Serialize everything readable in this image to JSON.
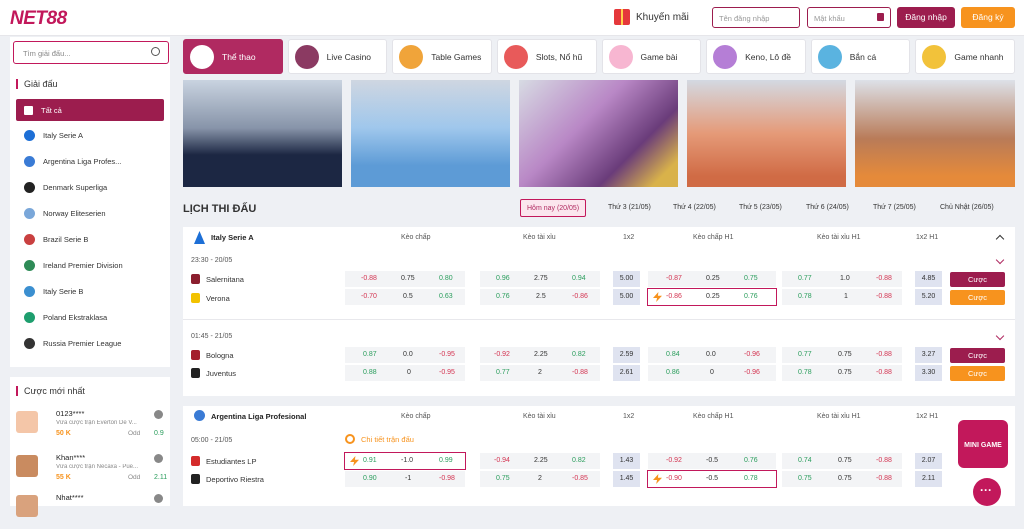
{
  "header": {
    "logo": "NET88",
    "promo": "Khuyến mãi",
    "user_placeholder": "Tên đăng nhập",
    "pass_placeholder": "Mật khẩu",
    "login": "Đăng nhập",
    "register": "Đăng ký"
  },
  "sidebar": {
    "search_placeholder": "Tìm giải đấu...",
    "section": "Giải đấu",
    "leagues": [
      "Tất cả",
      "Italy Serie A",
      "Argentina Liga Profes...",
      "Denmark Superliga",
      "Norway Eliteserien",
      "Brazil Serie B",
      "Ireland Premier Division",
      "Italy Serie B",
      "Poland Ekstraklasa",
      "Russia Premier League"
    ]
  },
  "recent": {
    "title": "Cược mới nhất",
    "bets": [
      {
        "user": "0123****",
        "desc": "Vừa cược trận Everton De V...",
        "amount": "50 K",
        "odd_label": "Odd",
        "odd": "0.9"
      },
      {
        "user": "Khan****",
        "desc": "Vừa cược trận Necaxa - Pue...",
        "amount": "55 K",
        "odd_label": "Odd",
        "odd": "2.11"
      },
      {
        "user": "Nhat****",
        "desc": "",
        "amount": "",
        "odd_label": "",
        "odd": ""
      }
    ]
  },
  "tabs": [
    "Thể thao",
    "Live Casino",
    "Table Games",
    "Slots, Nổ hũ",
    "Game bài",
    "Keno, Lô đề",
    "Bắn cá",
    "Game nhanh"
  ],
  "schedule": {
    "title": "LỊCH THI ĐẤU",
    "days": [
      "Hôm nay (20/05)",
      "Thứ 3 (21/05)",
      "Thứ 4 (22/05)",
      "Thứ 5 (23/05)",
      "Thứ 6 (24/05)",
      "Thứ 7 (25/05)",
      "Chủ Nhật (26/05)"
    ]
  },
  "cols": [
    "Kèo chấp",
    "Kèo tài xỉu",
    "1x2",
    "Kèo chấp H1",
    "Kèo tài xỉu H1",
    "1x2 H1"
  ],
  "bet_btn": "Cược",
  "league1": {
    "name": "Italy Serie A",
    "m1": {
      "time": "23:30 - 20/05",
      "t1": "Salernitana",
      "t2": "Verona",
      "r1": [
        "-0.88",
        "0.75",
        "0.80",
        "0.96",
        "2.75",
        "0.94",
        "5.00",
        "-0.87",
        "0.25",
        "0.75",
        "0.77",
        "1.0",
        "-0.88",
        "4.85"
      ],
      "r2": [
        "-0.70",
        "0.5",
        "0.63",
        "0.76",
        "2.5",
        "-0.86",
        "5.00",
        "-0.86",
        "0.25",
        "0.76",
        "0.78",
        "1",
        "-0.88",
        "5.20"
      ]
    },
    "m2": {
      "time": "01:45 - 21/05",
      "t1": "Bologna",
      "t2": "Juventus",
      "r1": [
        "0.87",
        "0.0",
        "-0.95",
        "-0.92",
        "2.25",
        "0.82",
        "2.59",
        "0.84",
        "0.0",
        "-0.96",
        "0.77",
        "0.75",
        "-0.88",
        "3.27"
      ],
      "r2": [
        "0.88",
        "0",
        "-0.95",
        "0.77",
        "2",
        "-0.88",
        "2.61",
        "0.86",
        "0",
        "-0.96",
        "0.78",
        "0.75",
        "-0.88",
        "3.30"
      ]
    }
  },
  "league2": {
    "name": "Argentina Liga Profesional",
    "time": "05:00 - 21/05",
    "detail": "Chi tiết trận đấu",
    "t1": "Estudiantes LP",
    "t2": "Deportivo Riestra",
    "r1": [
      "0.91",
      "-1.0",
      "0.99",
      "-0.94",
      "2.25",
      "0.82",
      "1.43",
      "-0.92",
      "-0.5",
      "0.76",
      "0.74",
      "0.75",
      "-0.88",
      "2.07"
    ],
    "r2": [
      "0.90",
      "-1",
      "-0.98",
      "0.75",
      "2",
      "-0.85",
      "1.45",
      "-0.90",
      "-0.5",
      "0.78",
      "0.75",
      "0.75",
      "-0.88",
      "2.11"
    ]
  },
  "mini_game": "MINI GAME",
  "colors": {
    "brand": "#c2185b",
    "accent": "#f7931e",
    "dark": "#9c1d4e"
  }
}
